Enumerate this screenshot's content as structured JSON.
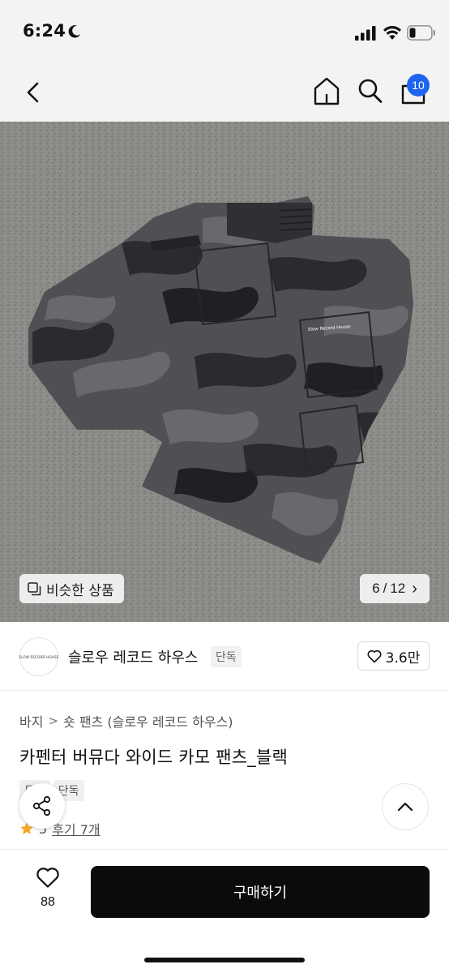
{
  "status_bar": {
    "time": "6:24",
    "icons": [
      "moon-icon",
      "signal-icon",
      "wifi-icon",
      "battery-icon"
    ]
  },
  "header": {
    "icons": [
      "back-arrow-icon",
      "home-icon",
      "search-icon",
      "cart-icon"
    ],
    "cart_count": "10",
    "badge_color": "#1e64f0"
  },
  "gallery": {
    "similar_label": "비슷한 상품",
    "page_current": "6",
    "page_separator": "/",
    "page_total": "12",
    "page_next_glyph": "›",
    "logo_on_shorts": "Slow Record House"
  },
  "shop": {
    "name": "슬로우 레코드 하우스",
    "tag": "단독",
    "logo_text": "SLOW RECORD HOUSE",
    "likes": "3.6만"
  },
  "product": {
    "breadcrumb": [
      "바지",
      "숏 팬츠 (슬로우 레코드 하우스)"
    ],
    "breadcrumb_sep": ">",
    "title": "카펜터 버뮤다 와이드 카모 팬츠_블랙",
    "badges": [
      "무료",
      "단독"
    ],
    "rating": "5",
    "review_text": "후기 7개"
  },
  "bottom_bar": {
    "wish_count": "88",
    "buy_label": "구매하기",
    "buy_color": "#0b0b0b"
  }
}
